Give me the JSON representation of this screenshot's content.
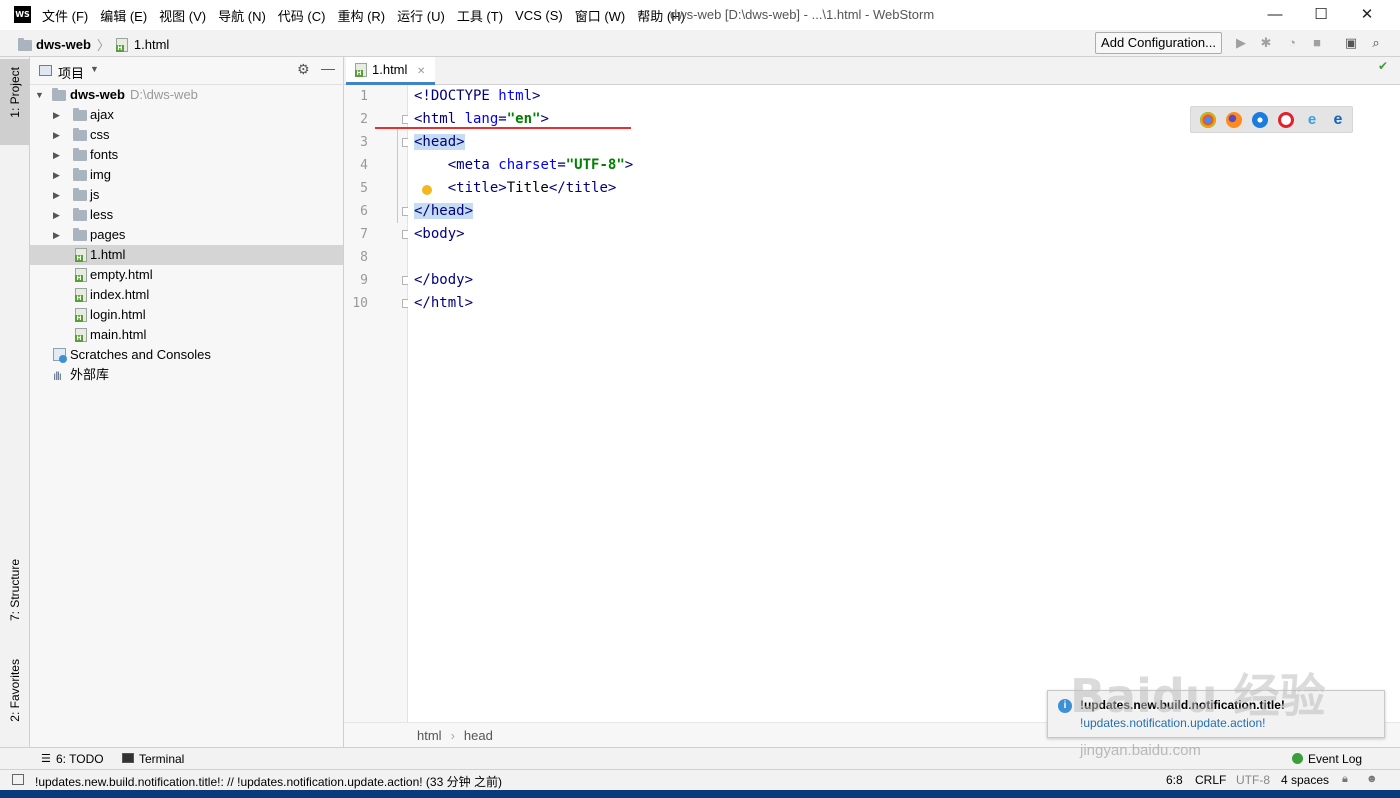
{
  "titlebar": {
    "logo": "WS",
    "menu": [
      "文件 (F)",
      "编辑 (E)",
      "视图 (V)",
      "导航 (N)",
      "代码 (C)",
      "重构 (R)",
      "运行 (U)",
      "工具 (T)",
      "VCS (S)",
      "窗口 (W)",
      "帮助 (H)"
    ],
    "window_title": "dws-web [D:\\dws-web] - ...\\1.html - WebStorm",
    "minimize": "—",
    "maximize": "☐",
    "close": "✕"
  },
  "navbar": {
    "project": "dws-web",
    "file": "1.html",
    "add_configuration": "Add Configuration..."
  },
  "left_stripe": {
    "project_tab": "1: Project",
    "structure_tab": "7: Structure",
    "favorites_tab": "2: Favorites"
  },
  "project_panel": {
    "title": "项目",
    "root_name": "dws-web",
    "root_path": "D:\\dws-web",
    "folders": [
      "ajax",
      "css",
      "fonts",
      "img",
      "js",
      "less",
      "pages"
    ],
    "files": [
      "1.html",
      "empty.html",
      "index.html",
      "login.html",
      "main.html"
    ],
    "scratches": "Scratches and Consoles",
    "external_libs": "外部库"
  },
  "editor": {
    "tab_label": "1.html",
    "line_numbers": [
      "1",
      "2",
      "3",
      "4",
      "5",
      "6",
      "7",
      "8",
      "9",
      "10"
    ],
    "breadcrumbs": [
      "html",
      "head"
    ]
  },
  "bottom_tools": {
    "todo": "6: TODO",
    "terminal": "Terminal",
    "event_log": "Event Log"
  },
  "status": {
    "message": "!updates.new.build.notification.title!: // !updates.notification.update.action! (33 分钟 之前)",
    "position": "6:8",
    "line_sep": "CRLF",
    "encoding": "UTF-8",
    "indent": "4 spaces"
  },
  "notification": {
    "title": "!updates.new.build.notification.title!",
    "action": "!updates.notification.update.action!"
  },
  "watermark": {
    "brand": "Baidu 经验",
    "url": "jingyan.baidu.com"
  },
  "colors": {
    "accent": "#4083c9",
    "tag": "#000080",
    "attr": "#0000ff",
    "string": "#008000",
    "highlight": "#c5dcf3",
    "caret_line": "#fffae3"
  }
}
